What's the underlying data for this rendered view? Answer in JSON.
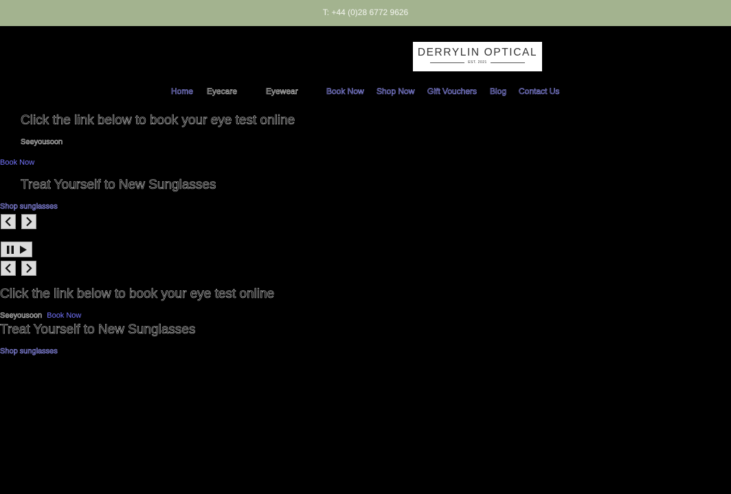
{
  "topbar": {
    "phone": "T: +44 (0)28 6772 9626"
  },
  "logo": {
    "name": "DERRYLIN OPTICAL",
    "est": "EST. 2021"
  },
  "nav": {
    "items": [
      {
        "label": "Home"
      },
      {
        "label": "Eyecare"
      },
      {
        "label": "Eyewear"
      },
      {
        "label": "Book Now"
      },
      {
        "label": "Shop Now"
      },
      {
        "label": "Gift Vouchers"
      },
      {
        "label": "Blog"
      },
      {
        "label": "Contact Us"
      }
    ]
  },
  "slides": [
    {
      "heading": "Click the link below to book your eye test online",
      "caption": "Seeyousoon",
      "link": "Book Now"
    },
    {
      "heading": "Treat Yourself to New Sunglasses",
      "link": "Shop sunglasses"
    }
  ],
  "controls": {
    "prev_icon": "chevron-left-icon",
    "next_icon": "chevron-right-icon",
    "pause_icon": "pause-icon",
    "play_icon": "play-icon"
  },
  "colors": {
    "topbar_bg": "#a3b38f",
    "page_bg": "#000000",
    "link": "#7575ff"
  }
}
